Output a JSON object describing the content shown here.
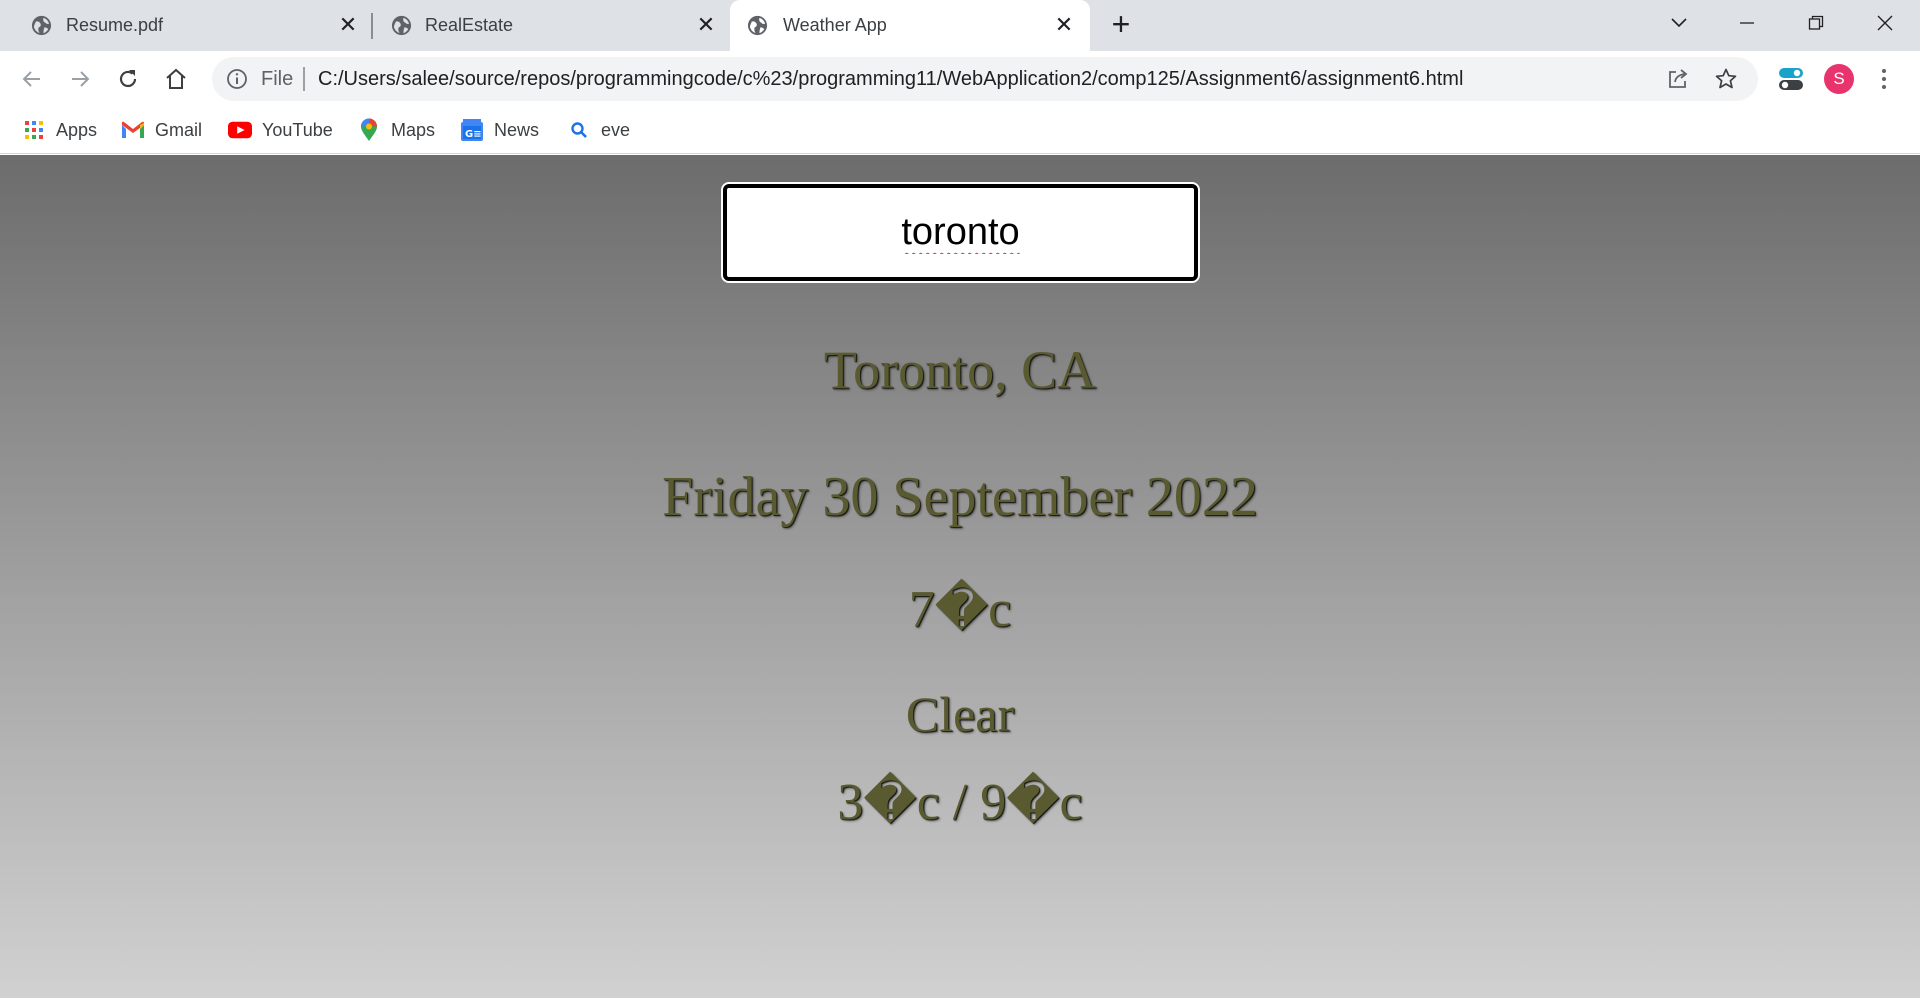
{
  "browser": {
    "tabs": [
      {
        "title": "Resume.pdf"
      },
      {
        "title": "RealEstate"
      },
      {
        "title": "Weather App"
      }
    ],
    "address_bar": {
      "scheme_label": "File",
      "url": "C:/Users/salee/source/repos/programmingcode/c%23/programming11/WebApplication2/comp125/Assignment6/assignment6.html"
    },
    "profile_initial": "S",
    "bookmarks": [
      {
        "label": "Apps",
        "icon": "apps-grid-icon"
      },
      {
        "label": "Gmail",
        "icon": "gmail-icon"
      },
      {
        "label": "YouTube",
        "icon": "youtube-icon"
      },
      {
        "label": "Maps",
        "icon": "maps-icon"
      },
      {
        "label": "News",
        "icon": "news-icon"
      },
      {
        "label": "eve",
        "icon": "search-icon"
      }
    ]
  },
  "weather_app": {
    "search_value": "toronto",
    "location": "Toronto, CA",
    "date": "Friday 30 September 2022",
    "temperature": "7�c",
    "condition": "Clear",
    "hi_low": "3�c / 9�c"
  },
  "colors": {
    "text": "#5a5a30",
    "gradient_top": "#6c6c6c",
    "gradient_bottom": "#d1d1d1",
    "profile": "#e8336d"
  }
}
